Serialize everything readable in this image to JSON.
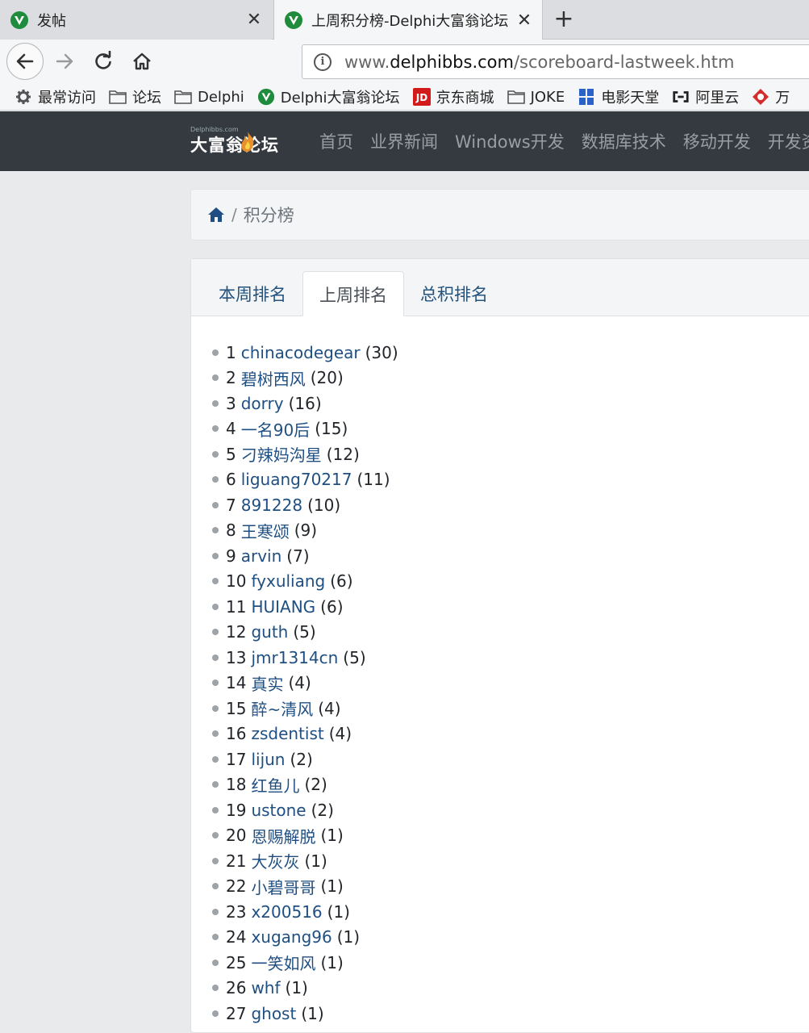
{
  "browser": {
    "tabs": [
      {
        "title": "发帖",
        "active": false
      },
      {
        "title": "上周积分榜-Delphi大富翁论坛",
        "active": true
      }
    ],
    "url_prefix": "www.",
    "url_domain": "delphibbs.com",
    "url_path": "/scoreboard-lastweek.htm",
    "bookmarks": [
      {
        "label": "最常访问",
        "icon": "gear-icon"
      },
      {
        "label": "论坛",
        "icon": "folder-icon"
      },
      {
        "label": "Delphi",
        "icon": "folder-icon"
      },
      {
        "label": "Delphi大富翁论坛",
        "icon": "site-shield-icon"
      },
      {
        "label": "京东商城",
        "icon": "jd-icon"
      },
      {
        "label": "JOKE",
        "icon": "folder-icon"
      },
      {
        "label": "电影天堂",
        "icon": "movie-icon"
      },
      {
        "label": "阿里云",
        "icon": "aliyun-icon"
      },
      {
        "label": "万",
        "icon": "wan-icon"
      }
    ]
  },
  "site": {
    "logo_small": "Delphibbs.com",
    "logo_text": "大富翁论坛",
    "nav": [
      "首页",
      "业界新闻",
      "Windows开发",
      "数据库技术",
      "移动开发",
      "开发资"
    ]
  },
  "breadcrumb": {
    "current": "积分榜"
  },
  "tabs": [
    "本周排名",
    "上周排名",
    "总积排名"
  ],
  "active_tab": 1,
  "ranking": [
    {
      "rank": "1",
      "user": "chinacodegear",
      "score": "(30)"
    },
    {
      "rank": "2",
      "user": "碧树西风",
      "score": "(20)"
    },
    {
      "rank": "3",
      "user": "dorry",
      "score": "(16)"
    },
    {
      "rank": "4",
      "user": "一名90后",
      "score": "(15)"
    },
    {
      "rank": "5",
      "user": "刁辣妈沟星",
      "score": "(12)"
    },
    {
      "rank": "6",
      "user": "liguang70217",
      "score": "(11)"
    },
    {
      "rank": "7",
      "user": "891228",
      "score": "(10)"
    },
    {
      "rank": "8",
      "user": "王寒颂",
      "score": "(9)"
    },
    {
      "rank": "9",
      "user": "arvin",
      "score": "(7)"
    },
    {
      "rank": "10",
      "user": "fyxuliang",
      "score": "(6)"
    },
    {
      "rank": "11",
      "user": "HUIANG",
      "score": "(6)"
    },
    {
      "rank": "12",
      "user": "guth",
      "score": "(5)"
    },
    {
      "rank": "13",
      "user": "jmr1314cn",
      "score": "(5)"
    },
    {
      "rank": "14",
      "user": "真实",
      "score": "(4)"
    },
    {
      "rank": "15",
      "user": "醉~清风",
      "score": "(4)"
    },
    {
      "rank": "16",
      "user": "zsdentist",
      "score": "(4)"
    },
    {
      "rank": "17",
      "user": "lijun",
      "score": "(2)"
    },
    {
      "rank": "18",
      "user": "红鱼儿",
      "score": "(2)"
    },
    {
      "rank": "19",
      "user": "ustone",
      "score": "(2)"
    },
    {
      "rank": "20",
      "user": "恩赐解脱",
      "score": "(1)"
    },
    {
      "rank": "21",
      "user": "大灰灰",
      "score": "(1)"
    },
    {
      "rank": "22",
      "user": "小碧哥哥",
      "score": "(1)"
    },
    {
      "rank": "23",
      "user": "x200516",
      "score": "(1)"
    },
    {
      "rank": "24",
      "user": "xugang96",
      "score": "(1)"
    },
    {
      "rank": "25",
      "user": "一笑如风",
      "score": "(1)"
    },
    {
      "rank": "26",
      "user": "whf",
      "score": "(1)"
    },
    {
      "rank": "27",
      "user": "ghost",
      "score": "(1)"
    }
  ]
}
